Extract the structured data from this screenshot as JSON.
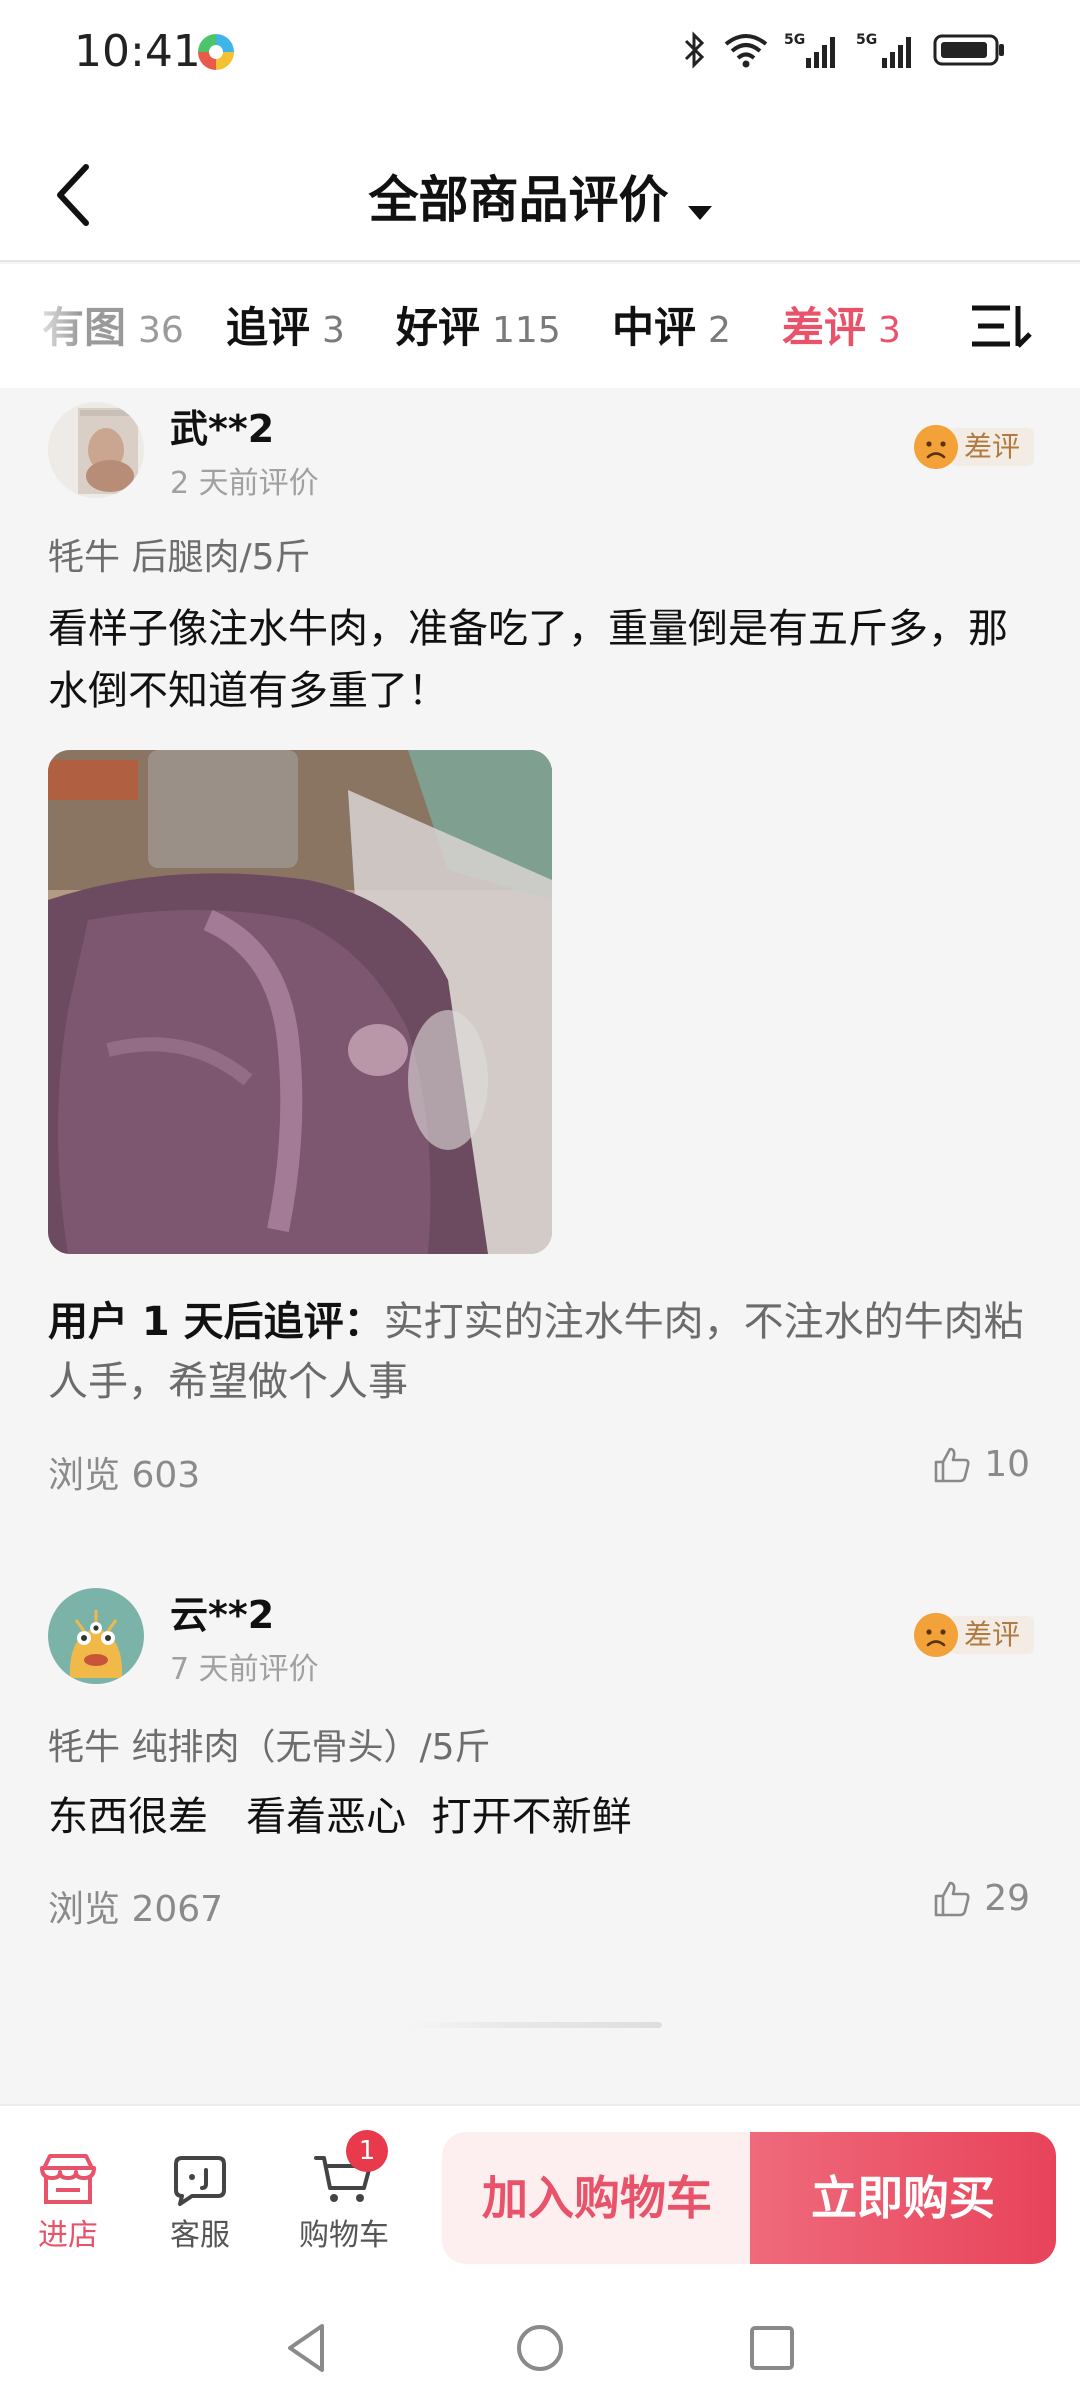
{
  "status_bar": {
    "time": "10:41",
    "network_labels": [
      "5G",
      "5G"
    ]
  },
  "header": {
    "title": "全部商品评价"
  },
  "filters": [
    {
      "label": "有图",
      "count": "36"
    },
    {
      "label": "追评",
      "count": "3"
    },
    {
      "label": "好评",
      "count": "115"
    },
    {
      "label": "中评",
      "count": "2"
    },
    {
      "label": "差评",
      "count": "3",
      "active": true
    }
  ],
  "reviews": [
    {
      "username": "武**2",
      "time": "2 天前评价",
      "rating": "差评",
      "sku": "牦牛 后腿肉/5斤",
      "content": "看样子像注水牛肉，准备吃了，重量倒是有五斤多，那水倒不知道有多重了！",
      "followup_label": "用户 1 天后追评：",
      "followup_text": "实打实的注水牛肉，不注水的牛肉粘人手，希望做个人事",
      "views": "浏览 603",
      "likes": "10"
    },
    {
      "username": "云**2",
      "time": "7 天前评价",
      "rating": "差评",
      "sku": "牦牛 纯排肉（无骨头）/5斤",
      "content": "东西很差   看着恶心  打开不新鲜",
      "views": "浏览 2067",
      "likes": "29"
    }
  ],
  "bottom_bar": {
    "store_label": "进店",
    "service_label": "客服",
    "cart_label": "购物车",
    "cart_badge": "1",
    "add_to_cart": "加入购物车",
    "buy_now": "立即购买"
  },
  "colors": {
    "accent": "#e8536a",
    "rating_badge_bg": "#f3ece4",
    "rating_badge_text": "#b07a40"
  }
}
